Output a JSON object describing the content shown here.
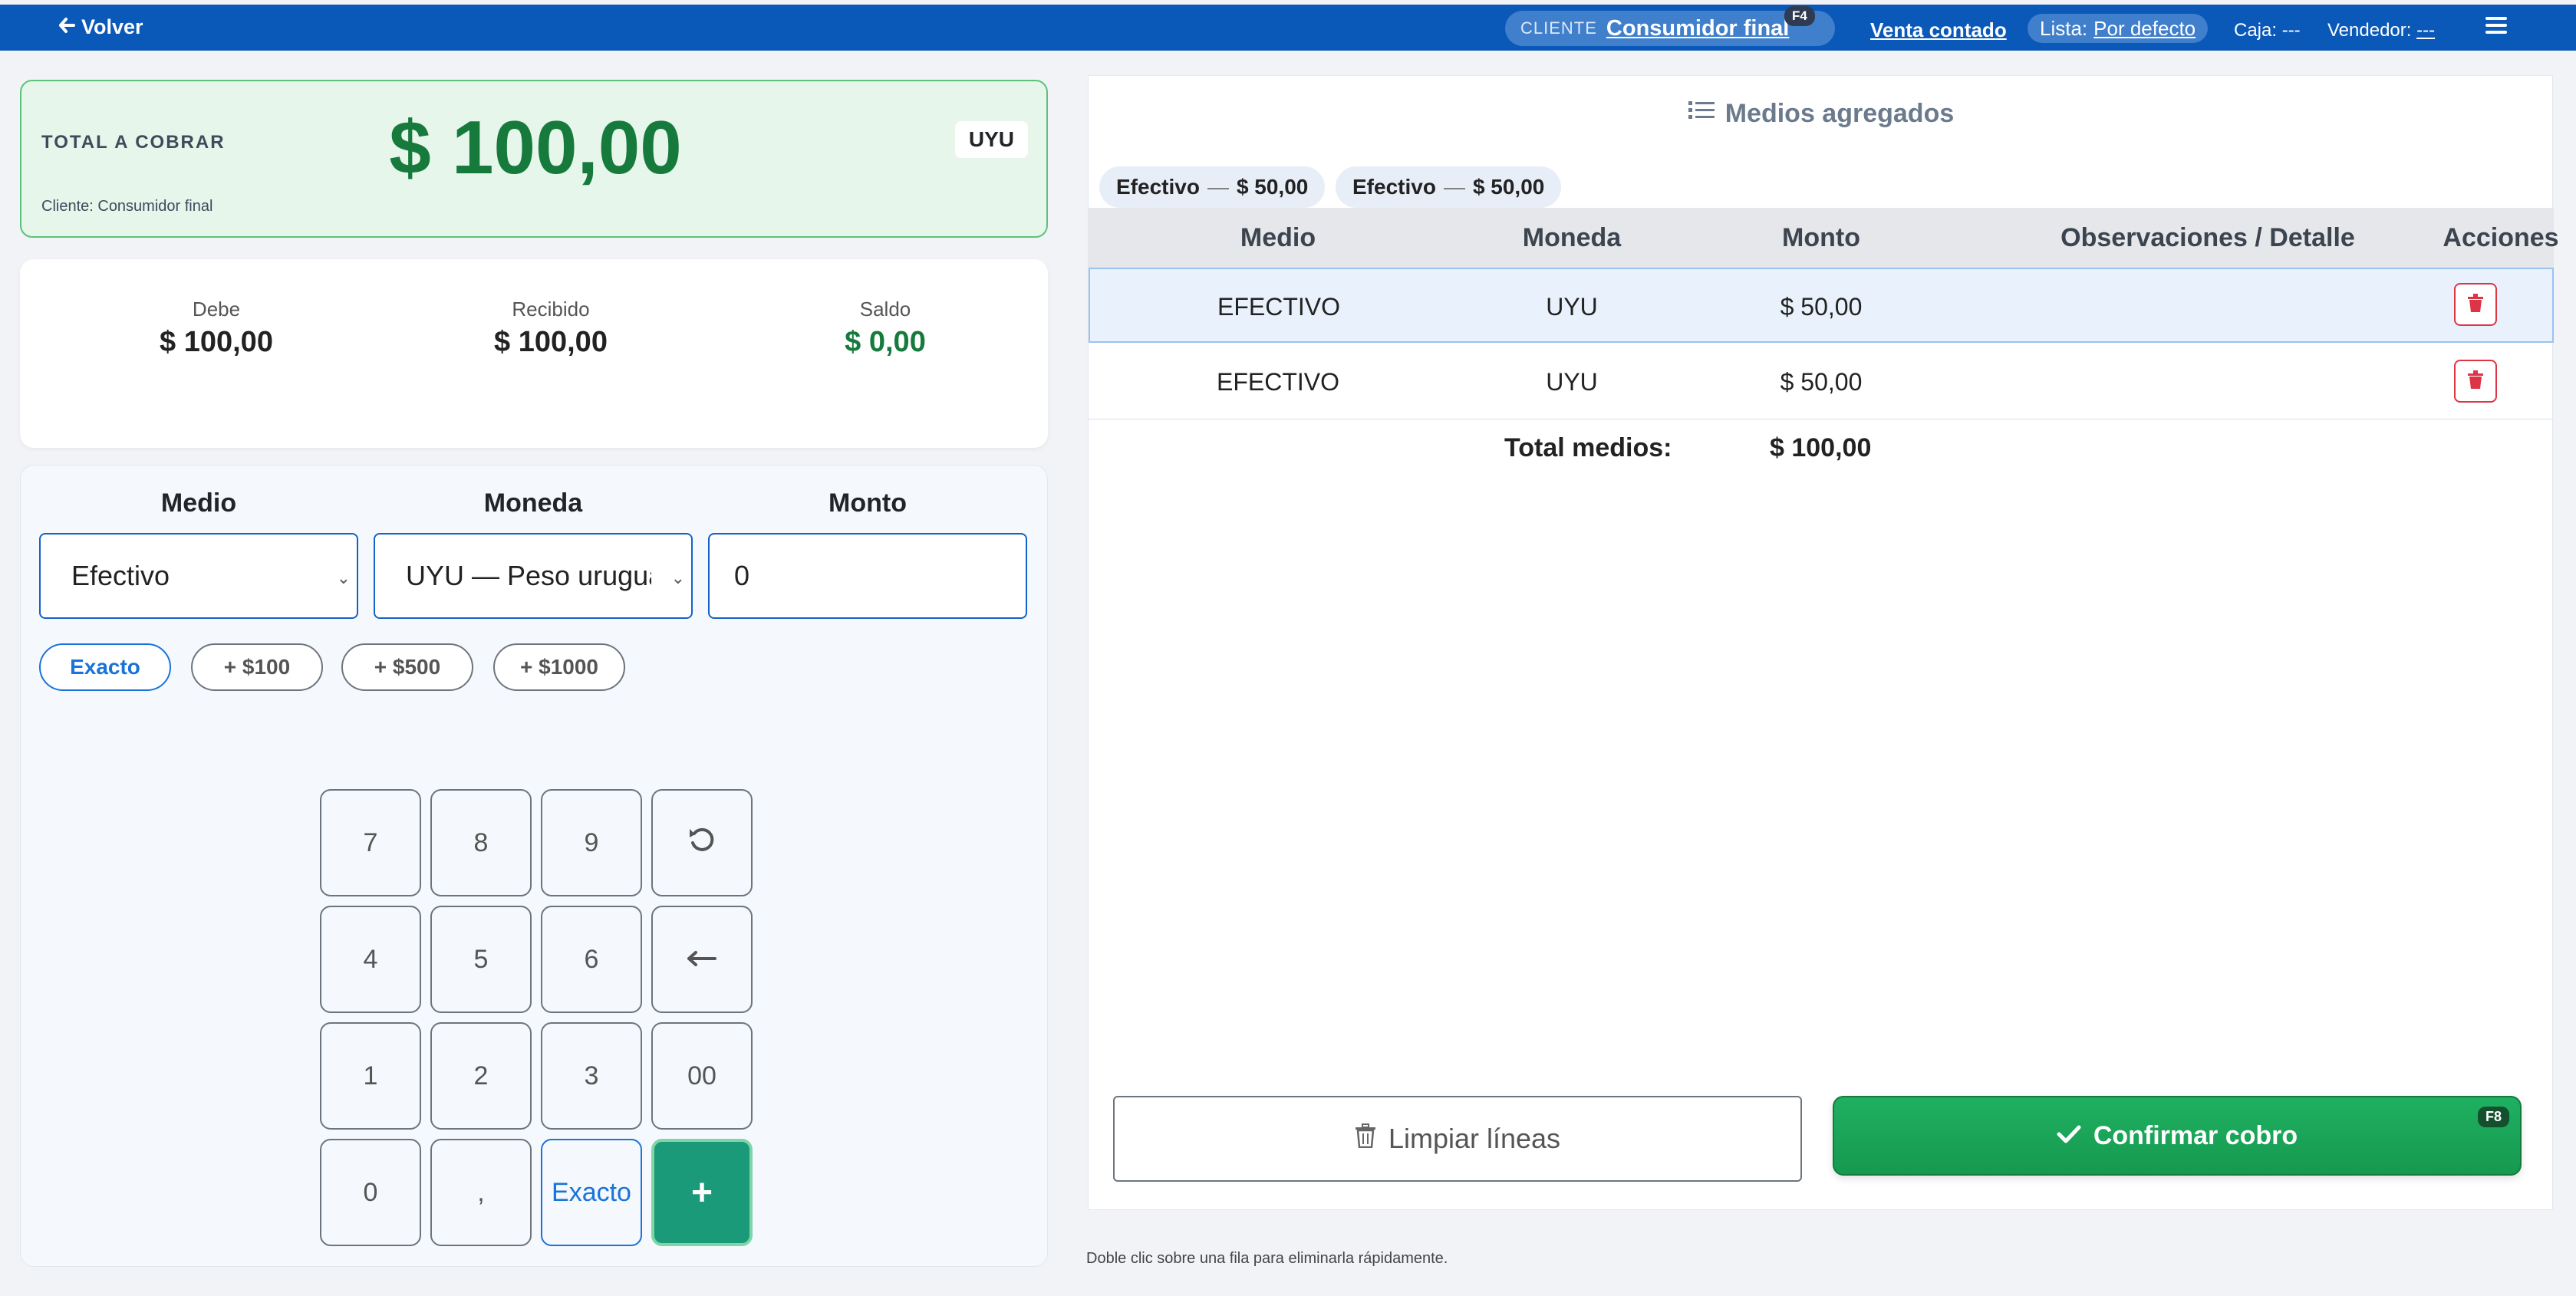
{
  "topbar": {
    "back_label": "Volver",
    "client_label": "CLIENTE",
    "client_value": "Consumidor final",
    "client_shortcut": "F4",
    "sale_type": "Venta contado",
    "price_list_label": "Lista:",
    "price_list_value": "Por defecto",
    "caja": "Caja: ---",
    "vendedor_label": "Vendedor:",
    "vendedor_value": "---"
  },
  "total": {
    "label": "TOTAL A COBRAR",
    "amount": "$ 100,00",
    "currency": "UYU",
    "client": "Cliente: Consumidor final"
  },
  "summary": {
    "debe_label": "Debe",
    "debe_value": "$ 100,00",
    "recibido_label": "Recibido",
    "recibido_value": "$ 100,00",
    "saldo_label": "Saldo",
    "saldo_value": "$ 0,00"
  },
  "entry": {
    "medio_label": "Medio",
    "moneda_label": "Moneda",
    "monto_label": "Monto",
    "medio_value": "Efectivo",
    "moneda_value": "UYU — Peso uruguayo",
    "monto_value": "0",
    "quick_buttons": [
      "Exacto",
      "+ $100",
      "+ $500",
      "+ $1000"
    ]
  },
  "keypad": {
    "keys": [
      "7",
      "8",
      "9",
      "4",
      "5",
      "6",
      "1",
      "2",
      "3",
      "00",
      "0",
      ",",
      "Exacto",
      "+"
    ]
  },
  "right": {
    "title": "Medios agregados",
    "chips": [
      {
        "medio": "Efectivo",
        "sep": "—",
        "amount": "$ 50,00"
      },
      {
        "medio": "Efectivo",
        "sep": "—",
        "amount": "$ 50,00"
      }
    ],
    "columns": [
      "Medio",
      "Moneda",
      "Monto",
      "Observaciones / Detalle",
      "Acciones"
    ],
    "rows": [
      {
        "medio": "EFECTIVO",
        "moneda": "UYU",
        "monto": "$ 50,00",
        "obs": ""
      },
      {
        "medio": "EFECTIVO",
        "moneda": "UYU",
        "monto": "$ 50,00",
        "obs": ""
      }
    ],
    "total_label": "Total medios:",
    "total_value": "$ 100,00",
    "clear_label": "Limpiar líneas",
    "confirm_label": "Confirmar cobro",
    "confirm_shortcut": "F8"
  },
  "hint": "Doble clic sobre una fila para eliminarla rápidamente."
}
